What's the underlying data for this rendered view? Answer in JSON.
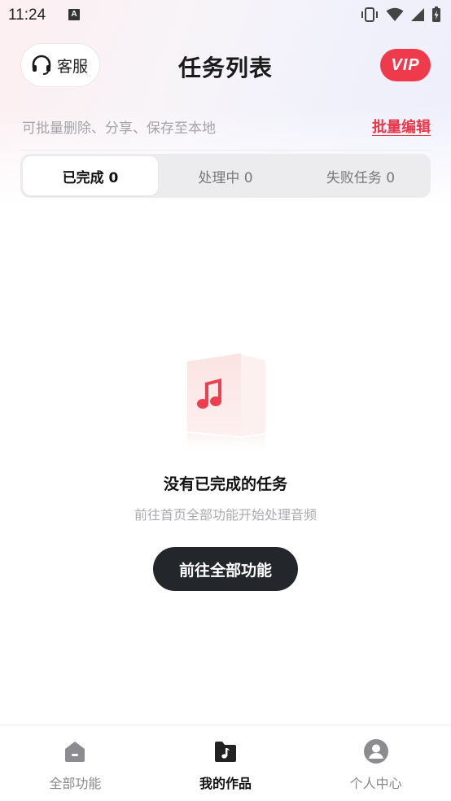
{
  "status_bar": {
    "time": "11:24",
    "notification_icon_letter": "A",
    "icons": [
      "vibrate-icon",
      "wifi-icon",
      "signal-icon",
      "battery-charging-icon"
    ]
  },
  "header": {
    "customer_service_label": "客服",
    "title": "任务列表",
    "vip_label": "VIP"
  },
  "toolbar": {
    "hint": "可批量删除、分享、保存至本地",
    "batch_edit_label": "批量编辑"
  },
  "tabs": [
    {
      "label": "已完成 0",
      "active": true
    },
    {
      "label": "处理中 0",
      "active": false
    },
    {
      "label": "失败任务 0",
      "active": false
    }
  ],
  "empty_state": {
    "icon": "music-document-icon",
    "title": "没有已完成的任务",
    "subtitle": "前往首页全部功能开始处理音频",
    "button_label": "前往全部功能"
  },
  "bottom_nav": [
    {
      "label": "全部功能",
      "icon": "home-icon",
      "active": false
    },
    {
      "label": "我的作品",
      "icon": "music-folder-icon",
      "active": true
    },
    {
      "label": "个人中心",
      "icon": "user-profile-icon",
      "active": false
    }
  ],
  "colors": {
    "accent_red": "#e8384a",
    "vip_red": "#ee3a4a",
    "dark_button": "#23262b",
    "muted_text": "#a3a3a8"
  }
}
